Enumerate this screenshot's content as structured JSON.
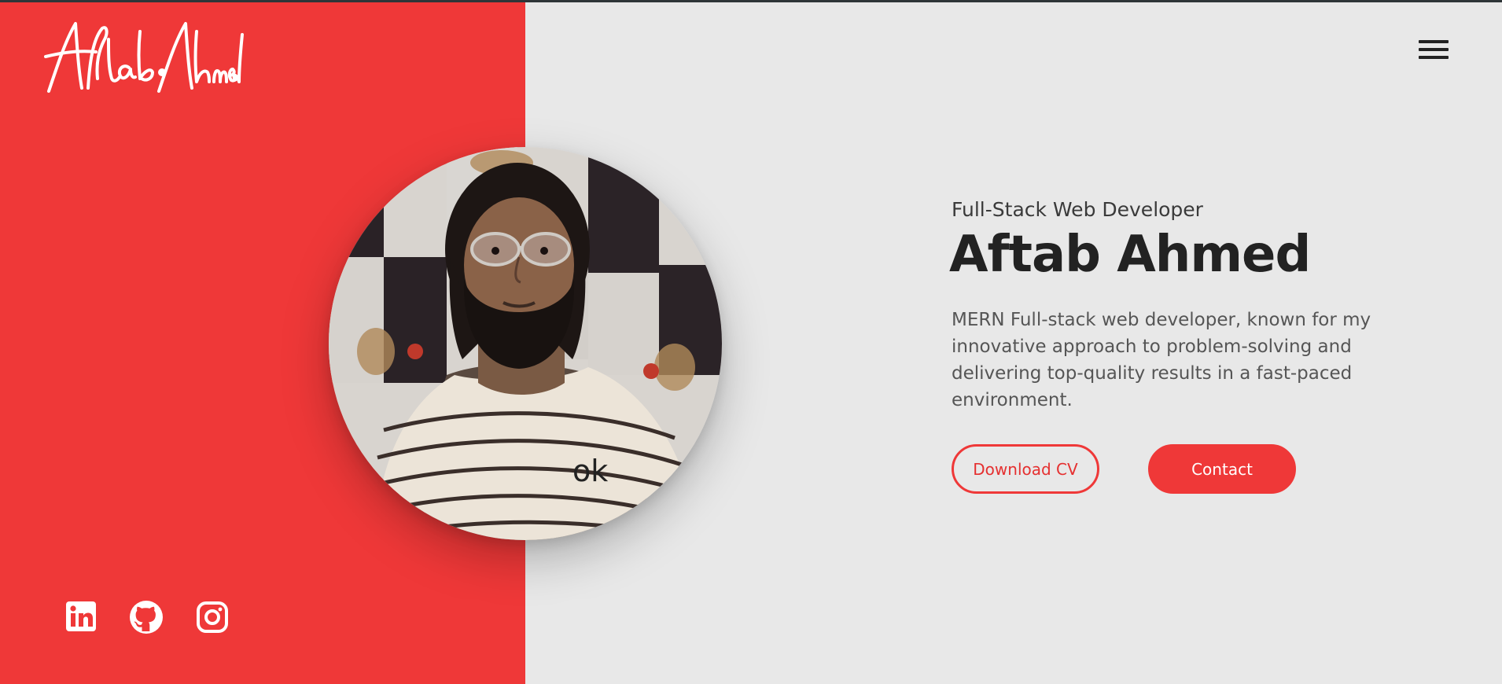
{
  "header": {
    "logo_text": "Aftab Ahmed",
    "menu_icon": "hamburger-menu-icon"
  },
  "hero": {
    "subtitle": "Full-Stack Web Developer",
    "name": "Aftab Ahmed",
    "description": "MERN Full-stack web developer, known for my innovative approach to problem-solving and delivering top-quality results in a fast-paced environment.",
    "download_label": "Download CV",
    "contact_label": "Contact"
  },
  "photo": {
    "shirt_print": "ok"
  },
  "socials": [
    {
      "icon": "linkedin-icon"
    },
    {
      "icon": "github-icon"
    },
    {
      "icon": "instagram-icon"
    }
  ],
  "colors": {
    "accent": "#ef3838",
    "background": "#e8e8e8",
    "heading": "#222222",
    "body_text": "#555555"
  }
}
